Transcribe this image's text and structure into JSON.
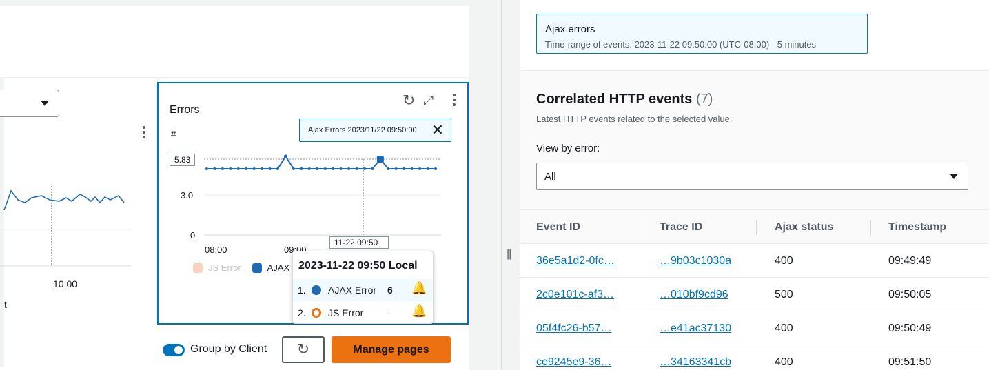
{
  "left": {
    "widget": {
      "title": "Errors",
      "unit": "#",
      "pinned_tooltip": "Ajax Errors 2023/11/22 09:50:00",
      "value_box": "5.83",
      "hover_x_label": "11-22 09:50",
      "y_ticks": [
        "5.83",
        "3.0",
        "0"
      ],
      "x_ticks": [
        "08:00",
        "09:00"
      ],
      "legend": [
        {
          "label": "JS Error",
          "color": "#f8d2c0"
        },
        {
          "label": "AJAX",
          "color": "#1f6ab0"
        }
      ]
    },
    "left_chart": {
      "x_tick": "10:00",
      "axis_label_fragment": "t"
    },
    "hover_popup": {
      "header": "2023-11-22 09:50 Local",
      "rows": [
        {
          "num": "1.",
          "label": "AJAX Error",
          "value": "6",
          "color": "#1f6ab0"
        },
        {
          "num": "2.",
          "label": "JS Error",
          "value": "-",
          "color": "#ec7211"
        }
      ]
    },
    "bottom": {
      "toggle_label": "Group by Client",
      "manage_label": "Manage pages"
    }
  },
  "right": {
    "selection": {
      "title": "Ajax errors",
      "range": "Time-range of events: 2023-11-22 09:50:00 (UTC-08:00) - 5 minutes"
    },
    "correlated": {
      "title": "Correlated HTTP events",
      "count": "(7)",
      "subtitle": "Latest HTTP events related to the selected value.",
      "view_label": "View by error:",
      "view_value": "All"
    },
    "table": {
      "columns": [
        "Event ID",
        "Trace ID",
        "Ajax status",
        "Timestamp"
      ],
      "rows": [
        {
          "event": "36e5a1d2-0fc…",
          "trace": "…9b03c1030a",
          "status": "400",
          "time": "09:49:49"
        },
        {
          "event": "2c0e101c-af3…",
          "trace": "…010bf9cd96",
          "status": "500",
          "time": "09:50:05"
        },
        {
          "event": "05f4fc26-b57…",
          "trace": "…e41ac37130",
          "status": "400",
          "time": "09:50:49"
        },
        {
          "event": "ce9245e9-36…",
          "trace": "…34163341cb",
          "status": "400",
          "time": "09:51:50"
        }
      ]
    }
  },
  "icons": {
    "refresh": "↻",
    "expand": "⤢",
    "close": "✕",
    "bell": "🔔",
    "splitter": "||"
  }
}
